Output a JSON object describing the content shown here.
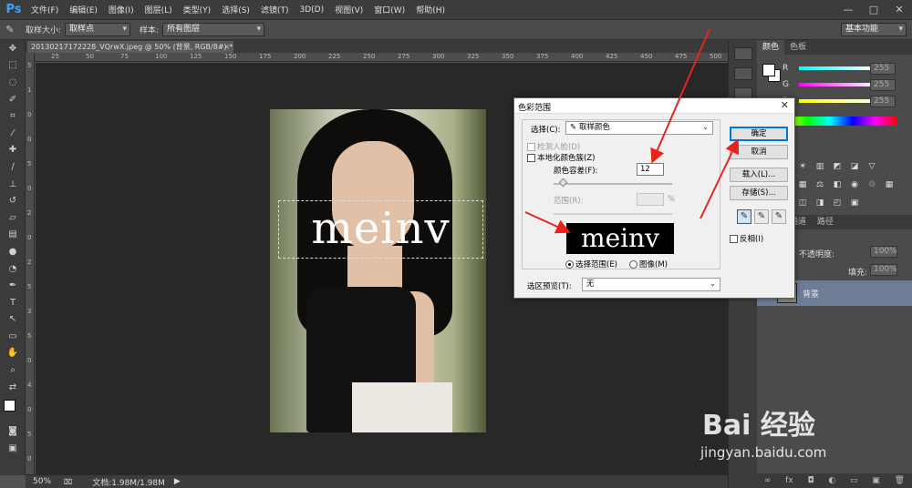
{
  "app": {
    "logo": "Ps"
  },
  "menu": [
    "文件(F)",
    "编辑(E)",
    "图像(I)",
    "图层(L)",
    "类型(Y)",
    "选择(S)",
    "滤镜(T)",
    "3D(D)",
    "视图(V)",
    "窗口(W)",
    "帮助(H)"
  ],
  "window_controls": {
    "minimize": "—",
    "maximize": "□",
    "close": "✕"
  },
  "options_bar": {
    "tool_icon": "eyedropper-icon",
    "sample_size_label": "取样大小:",
    "sample_size_value": "取样点",
    "sample_label": "样本:",
    "sample_value": "所有图层",
    "workspace": "基本功能"
  },
  "document": {
    "tab_title": "20130217172228_VQrwX.jpeg @ 50% (背景, RGB/8#) *",
    "tab_close": "×",
    "watermark_text": "meinv",
    "ruler_top": [
      "25",
      "50",
      "75",
      "100",
      "125",
      "150",
      "175",
      "200",
      "225",
      "250",
      "275",
      "300",
      "325",
      "350",
      "375",
      "400",
      "425",
      "450",
      "475",
      "500"
    ],
    "ruler_left": [
      "5",
      "1",
      "0",
      "0",
      "5",
      "0",
      "2",
      "0",
      "2",
      "5",
      "3",
      "5",
      "0",
      "4",
      "0",
      "5",
      "0"
    ]
  },
  "status": {
    "zoom": "50%",
    "doc_info": "文档:1.98M/1.98M"
  },
  "color_panel": {
    "tabs": [
      "颜色",
      "色板"
    ],
    "channels": [
      {
        "label": "R",
        "value": "255",
        "gradient": "linear-gradient(90deg,#0ff,#fff)"
      },
      {
        "label": "G",
        "value": "255",
        "gradient": "linear-gradient(90deg,#f0f,#fff)"
      },
      {
        "label": "B",
        "value": "255",
        "gradient": "linear-gradient(90deg,#ff0,#fff)"
      }
    ]
  },
  "layers_panel": {
    "tabs": [
      "通道",
      "路径"
    ],
    "opacity_label": "不透明度:",
    "opacity_value": "100%",
    "fill_label": "填充:",
    "fill_value": "100%",
    "layer_name": "背景",
    "bottom_icons": [
      "∞",
      "fx",
      "◘",
      "◐",
      "▭",
      "▣",
      "🗑"
    ]
  },
  "dialog": {
    "title": "色彩范围",
    "close": "✕",
    "select_label": "选择(C):",
    "select_value": "取样颜色",
    "detect_faces": "检测人脸(D)",
    "localized_clusters": "本地化颜色簇(Z)",
    "fuzziness_label": "颜色容差(F):",
    "fuzziness_value": "12",
    "range_label": "范围(R):",
    "range_value": "",
    "range_unit": "%",
    "preview_text": "meinv",
    "radio_selection": "选择范围(E)",
    "radio_image": "图像(M)",
    "selection_preview_label": "选区预览(T):",
    "selection_preview_value": "无",
    "buttons": {
      "ok": "确定",
      "cancel": "取消",
      "load": "载入(L)...",
      "save": "存储(S)..."
    },
    "invert": "反相(I)"
  },
  "watermark": {
    "brand": "Bai 经验",
    "url": "jingyan.baidu.com"
  },
  "colors": {
    "accent": "#1b6dc1",
    "arrow": "#e8231c",
    "layer_selected": "#6d7d96"
  }
}
